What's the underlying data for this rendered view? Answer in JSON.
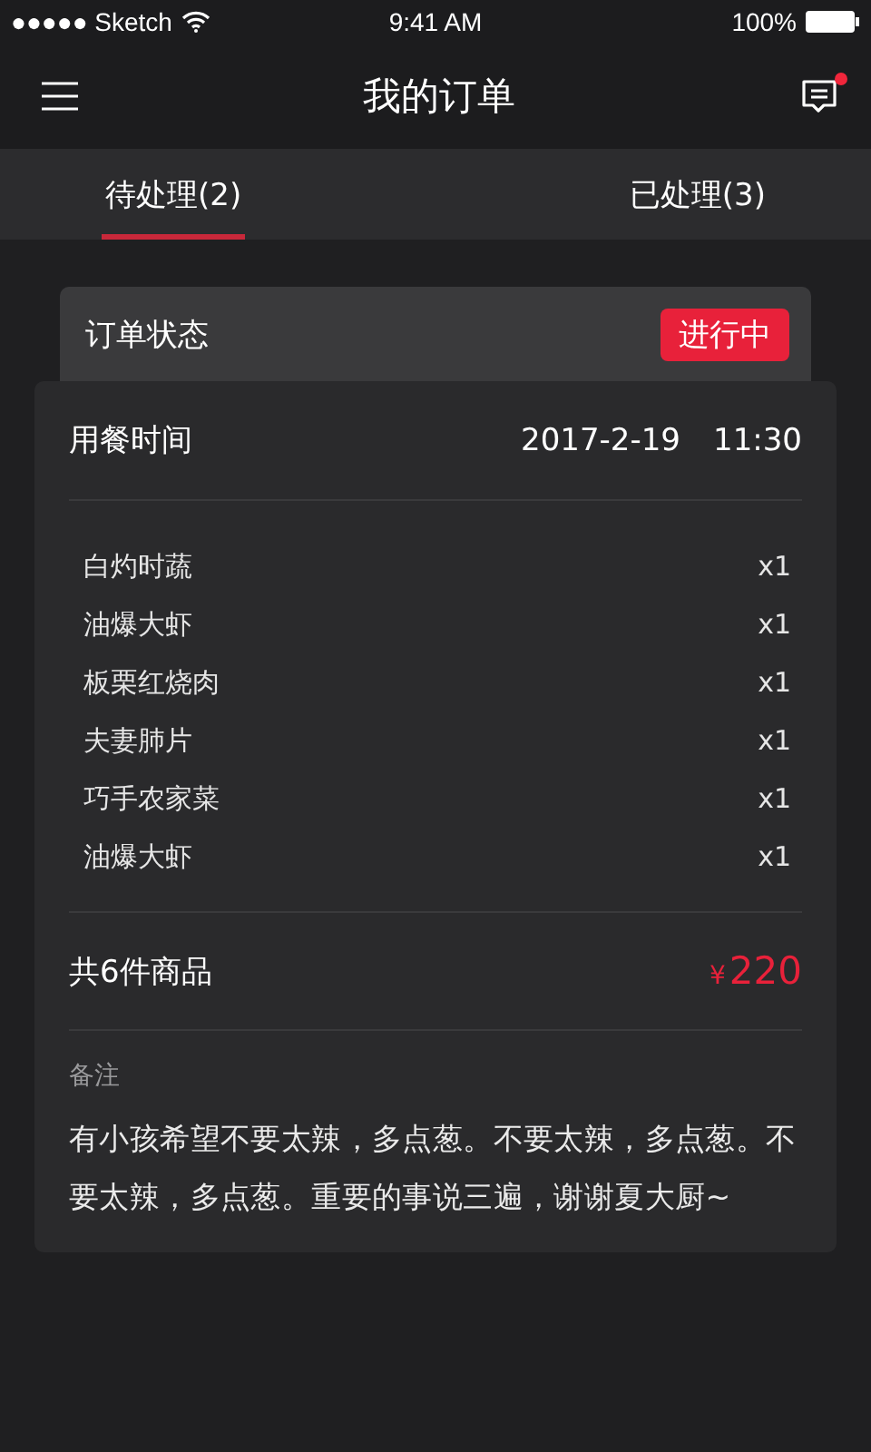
{
  "status_bar": {
    "carrier": "●●●●● Sketch",
    "time": "9:41 AM",
    "battery": "100%"
  },
  "header": {
    "title": "我的订单",
    "message_badge": true
  },
  "tabs": [
    {
      "label": "待处理(2)",
      "selected": true
    },
    {
      "label": "已处理(3)",
      "selected": false
    }
  ],
  "order": {
    "status_label": "订单状态",
    "status": "进行中",
    "time_label": "用餐时间",
    "date": "2017-2-19",
    "time": "11:30",
    "items": [
      {
        "name": "白灼时蔬",
        "qty": "x1"
      },
      {
        "name": "油爆大虾",
        "qty": "x1"
      },
      {
        "name": "板栗红烧肉",
        "qty": "x1"
      },
      {
        "name": "夫妻肺片",
        "qty": "x1"
      },
      {
        "name": "巧手农家菜",
        "qty": "x1"
      },
      {
        "name": "油爆大虾",
        "qty": "x1"
      }
    ],
    "total_label": "共6件商品",
    "currency": "¥",
    "total": "220",
    "note_label": "备注",
    "note": "有小孩希望不要太辣，多点葱。不要太辣，多点葱。不要太辣，多点葱。重要的事说三遍，谢谢夏大厨~"
  }
}
